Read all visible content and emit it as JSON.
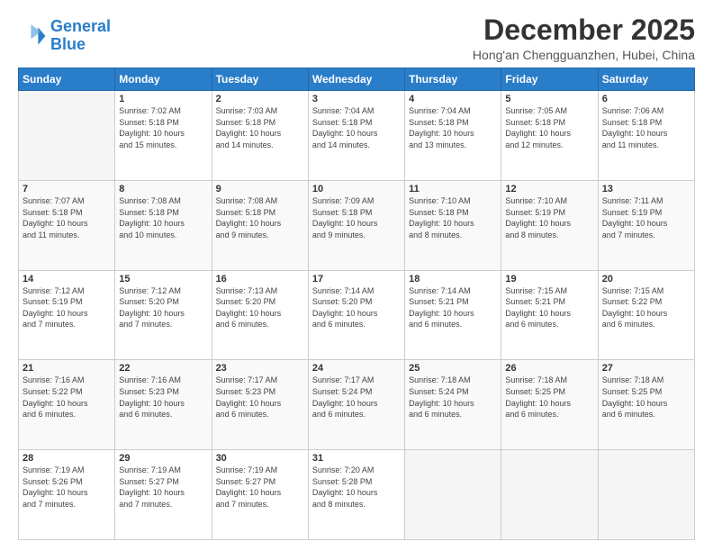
{
  "header": {
    "logo_line1": "General",
    "logo_line2": "Blue",
    "month_title": "December 2025",
    "location": "Hong'an Chengguanzhen, Hubei, China"
  },
  "weekdays": [
    "Sunday",
    "Monday",
    "Tuesday",
    "Wednesday",
    "Thursday",
    "Friday",
    "Saturday"
  ],
  "weeks": [
    [
      {
        "day": "",
        "info": ""
      },
      {
        "day": "1",
        "info": "Sunrise: 7:02 AM\nSunset: 5:18 PM\nDaylight: 10 hours\nand 15 minutes."
      },
      {
        "day": "2",
        "info": "Sunrise: 7:03 AM\nSunset: 5:18 PM\nDaylight: 10 hours\nand 14 minutes."
      },
      {
        "day": "3",
        "info": "Sunrise: 7:04 AM\nSunset: 5:18 PM\nDaylight: 10 hours\nand 14 minutes."
      },
      {
        "day": "4",
        "info": "Sunrise: 7:04 AM\nSunset: 5:18 PM\nDaylight: 10 hours\nand 13 minutes."
      },
      {
        "day": "5",
        "info": "Sunrise: 7:05 AM\nSunset: 5:18 PM\nDaylight: 10 hours\nand 12 minutes."
      },
      {
        "day": "6",
        "info": "Sunrise: 7:06 AM\nSunset: 5:18 PM\nDaylight: 10 hours\nand 11 minutes."
      }
    ],
    [
      {
        "day": "7",
        "info": "Sunrise: 7:07 AM\nSunset: 5:18 PM\nDaylight: 10 hours\nand 11 minutes."
      },
      {
        "day": "8",
        "info": "Sunrise: 7:08 AM\nSunset: 5:18 PM\nDaylight: 10 hours\nand 10 minutes."
      },
      {
        "day": "9",
        "info": "Sunrise: 7:08 AM\nSunset: 5:18 PM\nDaylight: 10 hours\nand 9 minutes."
      },
      {
        "day": "10",
        "info": "Sunrise: 7:09 AM\nSunset: 5:18 PM\nDaylight: 10 hours\nand 9 minutes."
      },
      {
        "day": "11",
        "info": "Sunrise: 7:10 AM\nSunset: 5:18 PM\nDaylight: 10 hours\nand 8 minutes."
      },
      {
        "day": "12",
        "info": "Sunrise: 7:10 AM\nSunset: 5:19 PM\nDaylight: 10 hours\nand 8 minutes."
      },
      {
        "day": "13",
        "info": "Sunrise: 7:11 AM\nSunset: 5:19 PM\nDaylight: 10 hours\nand 7 minutes."
      }
    ],
    [
      {
        "day": "14",
        "info": "Sunrise: 7:12 AM\nSunset: 5:19 PM\nDaylight: 10 hours\nand 7 minutes."
      },
      {
        "day": "15",
        "info": "Sunrise: 7:12 AM\nSunset: 5:20 PM\nDaylight: 10 hours\nand 7 minutes."
      },
      {
        "day": "16",
        "info": "Sunrise: 7:13 AM\nSunset: 5:20 PM\nDaylight: 10 hours\nand 6 minutes."
      },
      {
        "day": "17",
        "info": "Sunrise: 7:14 AM\nSunset: 5:20 PM\nDaylight: 10 hours\nand 6 minutes."
      },
      {
        "day": "18",
        "info": "Sunrise: 7:14 AM\nSunset: 5:21 PM\nDaylight: 10 hours\nand 6 minutes."
      },
      {
        "day": "19",
        "info": "Sunrise: 7:15 AM\nSunset: 5:21 PM\nDaylight: 10 hours\nand 6 minutes."
      },
      {
        "day": "20",
        "info": "Sunrise: 7:15 AM\nSunset: 5:22 PM\nDaylight: 10 hours\nand 6 minutes."
      }
    ],
    [
      {
        "day": "21",
        "info": "Sunrise: 7:16 AM\nSunset: 5:22 PM\nDaylight: 10 hours\nand 6 minutes."
      },
      {
        "day": "22",
        "info": "Sunrise: 7:16 AM\nSunset: 5:23 PM\nDaylight: 10 hours\nand 6 minutes."
      },
      {
        "day": "23",
        "info": "Sunrise: 7:17 AM\nSunset: 5:23 PM\nDaylight: 10 hours\nand 6 minutes."
      },
      {
        "day": "24",
        "info": "Sunrise: 7:17 AM\nSunset: 5:24 PM\nDaylight: 10 hours\nand 6 minutes."
      },
      {
        "day": "25",
        "info": "Sunrise: 7:18 AM\nSunset: 5:24 PM\nDaylight: 10 hours\nand 6 minutes."
      },
      {
        "day": "26",
        "info": "Sunrise: 7:18 AM\nSunset: 5:25 PM\nDaylight: 10 hours\nand 6 minutes."
      },
      {
        "day": "27",
        "info": "Sunrise: 7:18 AM\nSunset: 5:25 PM\nDaylight: 10 hours\nand 6 minutes."
      }
    ],
    [
      {
        "day": "28",
        "info": "Sunrise: 7:19 AM\nSunset: 5:26 PM\nDaylight: 10 hours\nand 7 minutes."
      },
      {
        "day": "29",
        "info": "Sunrise: 7:19 AM\nSunset: 5:27 PM\nDaylight: 10 hours\nand 7 minutes."
      },
      {
        "day": "30",
        "info": "Sunrise: 7:19 AM\nSunset: 5:27 PM\nDaylight: 10 hours\nand 7 minutes."
      },
      {
        "day": "31",
        "info": "Sunrise: 7:20 AM\nSunset: 5:28 PM\nDaylight: 10 hours\nand 8 minutes."
      },
      {
        "day": "",
        "info": ""
      },
      {
        "day": "",
        "info": ""
      },
      {
        "day": "",
        "info": ""
      }
    ]
  ]
}
